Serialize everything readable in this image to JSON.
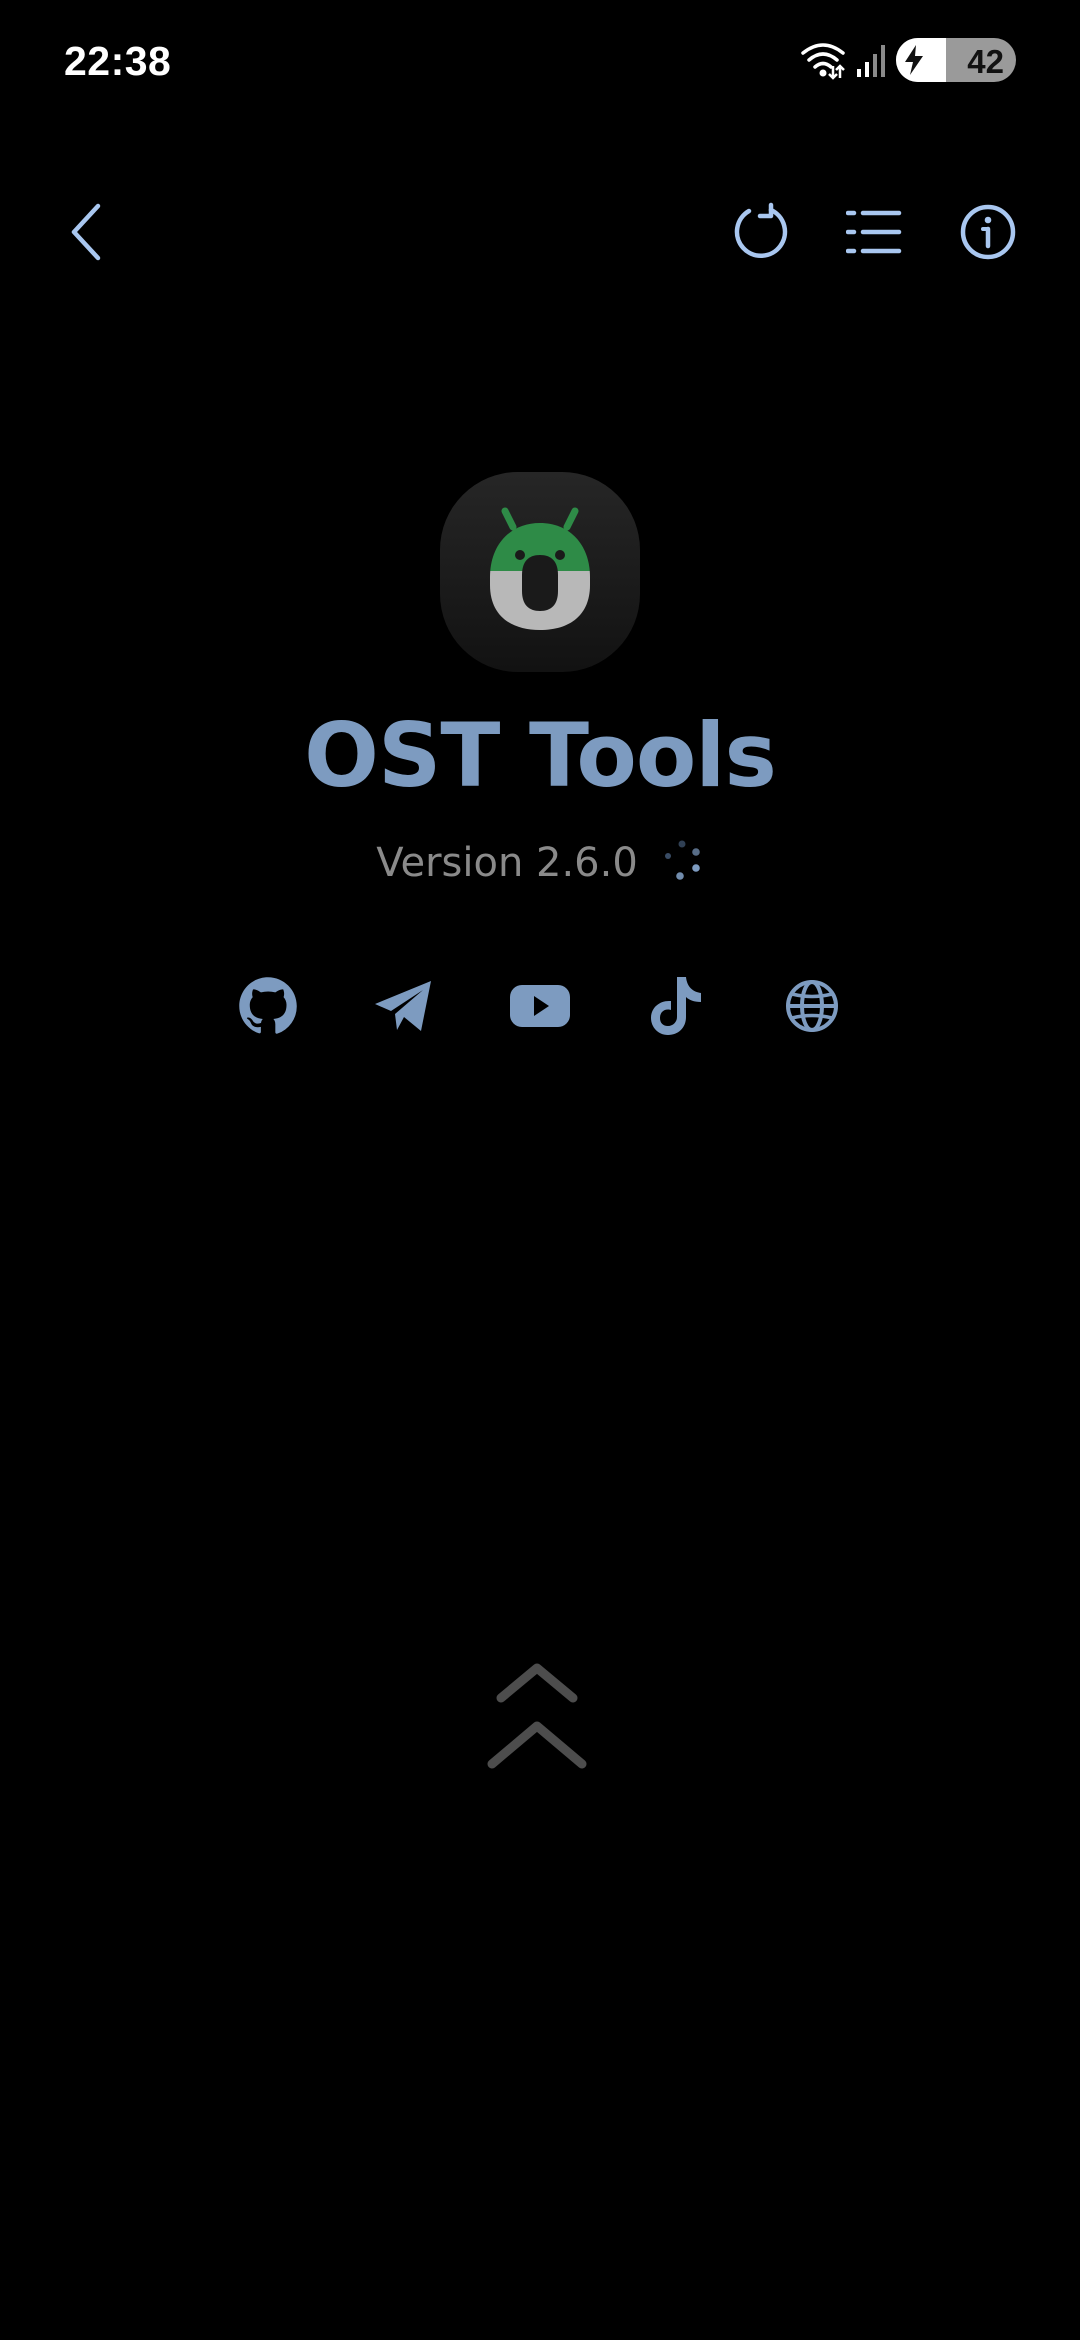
{
  "status_bar": {
    "time": "22:38",
    "battery_level": "42",
    "battery_percent": 42,
    "icons": [
      "wifi-icon",
      "signal-icon",
      "battery-charging-icon"
    ]
  },
  "toolbar": {
    "icons": [
      "back-arrow-icon",
      "refresh-icon",
      "list-icon",
      "info-icon"
    ]
  },
  "app": {
    "name": "OST Tools",
    "version": "Version 2.6.0",
    "icon": "android-o-logo"
  },
  "social_links": [
    "github-icon",
    "telegram-icon",
    "youtube-icon",
    "tiktok-icon",
    "globe-icon"
  ],
  "colors": {
    "background": "#000000",
    "accent": "#7d9bc0",
    "toolbar_icon": "#a9c7f0",
    "logo_green": "#2e8b47",
    "logo_gray": "#b8b8b8",
    "text_secondary": "#8a8a8a"
  }
}
